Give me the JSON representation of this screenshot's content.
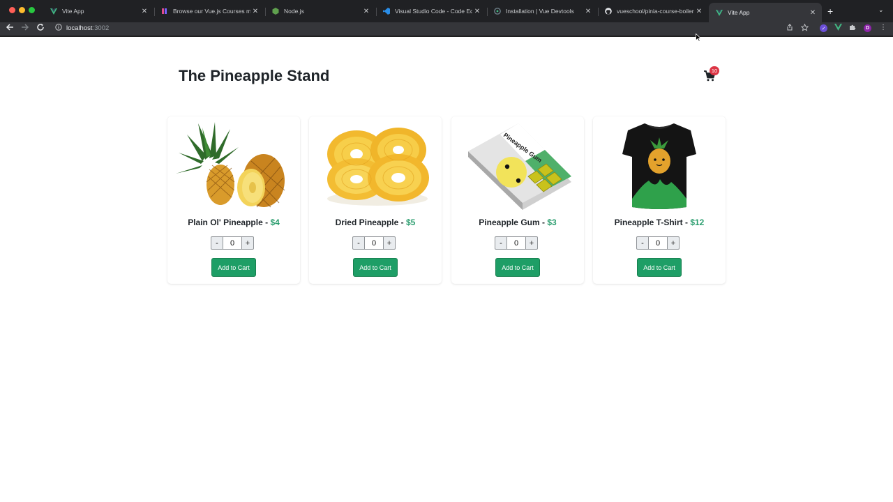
{
  "browser": {
    "tabs": [
      {
        "title": "Vite App",
        "icon": "vue-icon",
        "active": false
      },
      {
        "title": "Browse our Vue.js Courses mast",
        "icon": "vueschool-icon",
        "active": false
      },
      {
        "title": "Node.js",
        "icon": "nodejs-icon",
        "active": false
      },
      {
        "title": "Visual Studio Code - Code Editi",
        "icon": "vscode-icon",
        "active": false
      },
      {
        "title": "Installation | Vue Devtools",
        "icon": "vue-devtools-icon",
        "active": false
      },
      {
        "title": "vueschool/pinia-course-boilerp",
        "icon": "github-icon",
        "active": false
      },
      {
        "title": "Vite App",
        "icon": "vue-icon",
        "active": true
      }
    ],
    "address": {
      "host": "localhost",
      "port": ":3002"
    }
  },
  "page": {
    "title": "The Pineapple Stand",
    "cart": {
      "count": "10"
    },
    "colors": {
      "accent": "#1e9e66",
      "price": "#2a9d6e",
      "badge": "#dc3545",
      "title": "#1f2429"
    },
    "products": [
      {
        "name": "Plain Ol' Pineapple",
        "separator": " - ",
        "price": "$4",
        "quantity": "0",
        "minus": "-",
        "plus": "+",
        "button": "Add to Cart"
      },
      {
        "name": "Dried Pineapple",
        "separator": " - ",
        "price": "$5",
        "quantity": "0",
        "minus": "-",
        "plus": "+",
        "button": "Add to Cart"
      },
      {
        "name": "Pineapple Gum",
        "separator": " - ",
        "price": "$3",
        "quantity": "0",
        "minus": "-",
        "plus": "+",
        "button": "Add to Cart"
      },
      {
        "name": "Pineapple T-Shirt",
        "separator": " - ",
        "price": "$12",
        "quantity": "0",
        "minus": "-",
        "plus": "+",
        "button": "Add to Cart"
      }
    ],
    "product_images": {
      "gum_label": "Pineapple Gum"
    }
  }
}
